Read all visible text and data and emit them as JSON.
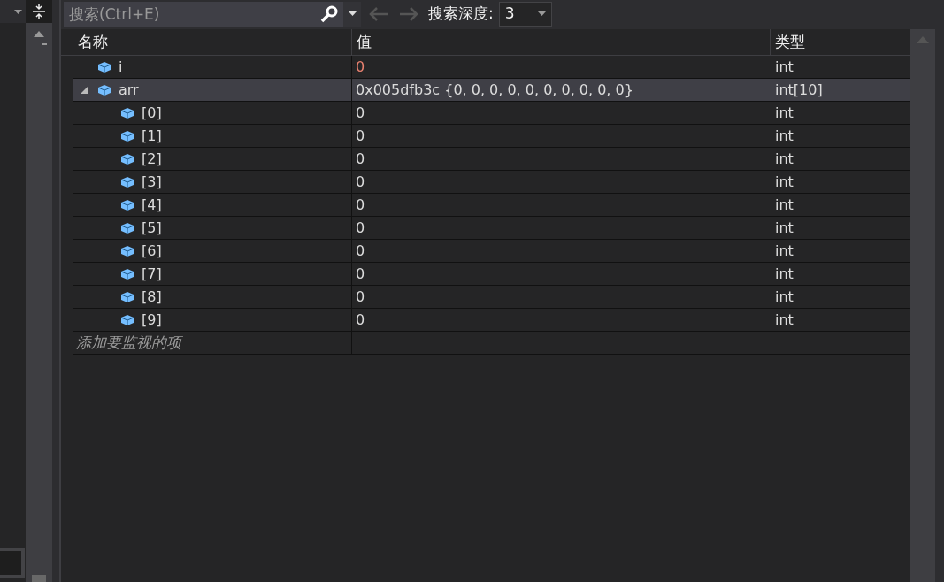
{
  "toolbar": {
    "search": {
      "placeholder": "搜索(Ctrl+E)"
    },
    "back_enabled": false,
    "forward_enabled": false,
    "depth_label": "搜索深度:",
    "depth_value": "3"
  },
  "table": {
    "columns": [
      "名称",
      "值",
      "类型"
    ],
    "rows": [
      {
        "name": "i",
        "value": "0",
        "type": "int",
        "changed": true,
        "selected": false
      },
      {
        "name": "arr",
        "value": "0x005dfb3c {0, 0, 0, 0, 0, 0, 0, 0, 0, 0}",
        "type": "int[10]",
        "changed": false,
        "selected": true,
        "expanded": true,
        "children": [
          {
            "name": "[0]",
            "value": "0",
            "type": "int",
            "changed": false,
            "selected": false
          },
          {
            "name": "[1]",
            "value": "0",
            "type": "int",
            "changed": false,
            "selected": false
          },
          {
            "name": "[2]",
            "value": "0",
            "type": "int",
            "changed": false,
            "selected": false
          },
          {
            "name": "[3]",
            "value": "0",
            "type": "int",
            "changed": false,
            "selected": false
          },
          {
            "name": "[4]",
            "value": "0",
            "type": "int",
            "changed": false,
            "selected": false
          },
          {
            "name": "[5]",
            "value": "0",
            "type": "int",
            "changed": false,
            "selected": false
          },
          {
            "name": "[6]",
            "value": "0",
            "type": "int",
            "changed": false,
            "selected": false
          },
          {
            "name": "[7]",
            "value": "0",
            "type": "int",
            "changed": false,
            "selected": false
          },
          {
            "name": "[8]",
            "value": "0",
            "type": "int",
            "changed": false,
            "selected": false
          },
          {
            "name": "[9]",
            "value": "0",
            "type": "int",
            "changed": false,
            "selected": false
          }
        ]
      }
    ],
    "add_item": {
      "placeholder": "添加要监视的项"
    }
  }
}
